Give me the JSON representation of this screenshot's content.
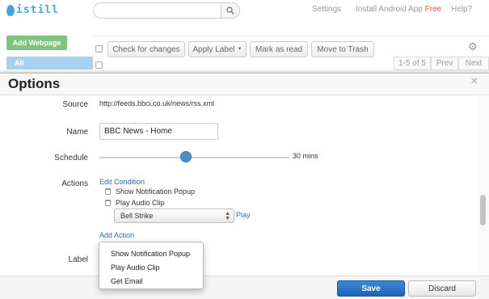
{
  "app": {
    "logo_text": "istill",
    "search_placeholder": "",
    "top_links": {
      "settings": "Settings",
      "install_prefix": "Install Android App",
      "install_free": "Free",
      "help": "Help?"
    },
    "add_webpage": "Add Webpage",
    "sidebar_all": "All",
    "toolbar": {
      "check_changes": "Check for changes",
      "apply_label": "Apply Label",
      "mark_read": "Mark as read",
      "move_trash": "Move to Trash"
    },
    "pager": {
      "range": "1-5 of 5",
      "prev": "Prev",
      "next": "Next"
    }
  },
  "modal": {
    "title": "Options",
    "close": "×",
    "fields": {
      "source_label": "Source",
      "source_value": "http://feeds.bbci.co.uk/news/rss.xml",
      "name_label": "Name",
      "name_value": "BBC News - Home",
      "schedule_label": "Schedule",
      "schedule_value": "30 mins",
      "schedule_slider_fraction": 0.46,
      "actions_label": "Actions",
      "edit_condition": "Edit Condition",
      "actions": [
        "Show Notification Popup",
        "Play Audio Clip"
      ],
      "audio_clip": "Bell Strike",
      "play": "Play",
      "add_action": "Add Action",
      "label_label": "Label"
    },
    "add_action_menu": [
      "Show Notification Popup",
      "Play Audio Clip",
      "Get Email"
    ],
    "footer": {
      "save": "Save",
      "discard": "Discard"
    }
  },
  "colors": {
    "accent_blue": "#1f62b5",
    "link_blue": "#2a6cb3",
    "add_webpage_green": "#7ec47e",
    "free_red": "#e0584a",
    "logo_blue": "#4aa3df"
  }
}
